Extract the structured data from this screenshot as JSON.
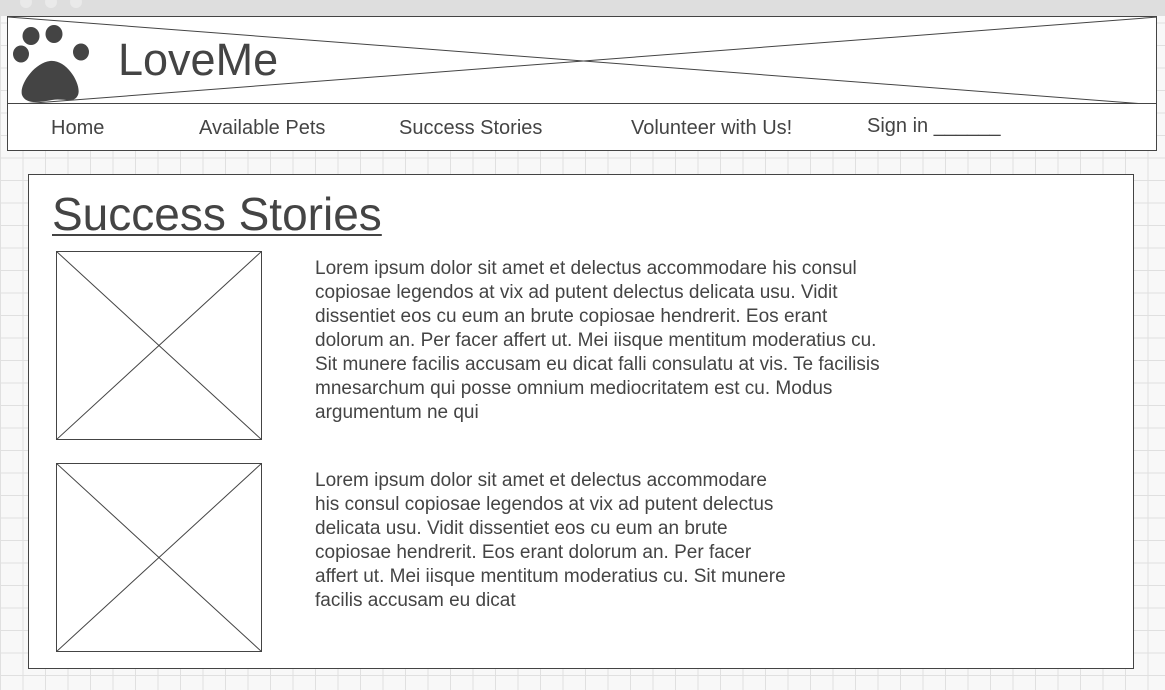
{
  "app": {
    "brand": "LoveMe"
  },
  "nav": {
    "items": [
      {
        "label": "Home"
      },
      {
        "label": "Available Pets"
      },
      {
        "label": "Success Stories"
      },
      {
        "label": "Volunteer with Us!"
      }
    ],
    "sign_in": "Sign in ______"
  },
  "main": {
    "title": "Success Stories",
    "stories": [
      {
        "image_placeholder": "image-placeholder",
        "text": "Lorem ipsum dolor sit amet et delectus accommodare his consul copiosae legendos at vix ad putent delectus delicata usu. Vidit dissentiet eos cu eum an brute copiosae hendrerit. Eos erant dolorum an. Per facer affert ut. Mei iisque mentitum moderatius cu. Sit munere facilis accusam eu dicat falli consulatu at vis. Te facilisis mnesarchum qui posse omnium mediocritatem est cu. Modus argumentum ne qui"
      },
      {
        "image_placeholder": "image-placeholder",
        "text": "Lorem ipsum dolor sit amet et delectus accommodare his consul copiosae legendos at vix ad putent delectus delicata usu. Vidit dissentiet eos cu eum an brute copiosae hendrerit. Eos erant dolorum an. Per facer affert ut. Mei iisque mentitum moderatius cu. Sit munere facilis accusam eu dicat"
      }
    ]
  },
  "icons": {
    "logo": "paw-icon"
  },
  "colors": {
    "ink": "#444444",
    "background": "#f8f8f8",
    "grid": "#e0e0e0",
    "titlebar": "#dedede"
  }
}
